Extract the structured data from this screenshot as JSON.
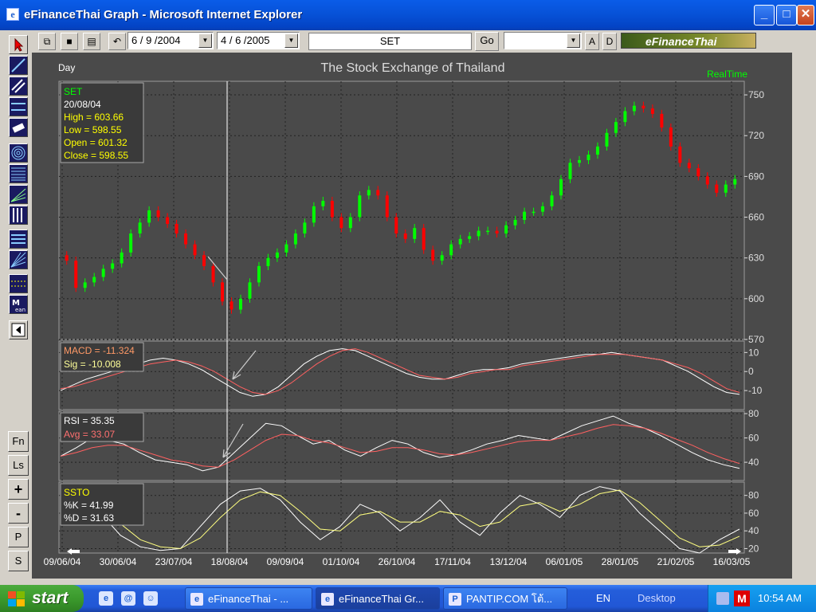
{
  "window": {
    "title": "eFinanceThai Graph - Microsoft Internet Explorer",
    "app_icon": "e",
    "minimize": "_",
    "maximize": "□",
    "close": "✕"
  },
  "toolbar": {
    "from_date": "6 / 9 /2004",
    "to_date": "4 / 6 /2005",
    "symbol": "SET",
    "go_label": "Go",
    "btn_a": "A",
    "btn_d": "D",
    "logo_text": "eFinanceThai"
  },
  "left_buttons": [
    "Fn",
    "Ls",
    "+",
    "-",
    "P",
    "S"
  ],
  "chart": {
    "period_label": "Day",
    "title": "The Stock Exchange of Thailand",
    "realtime_label": "RealTime",
    "colors": {
      "up": "#00ff00",
      "down": "#ff0000",
      "macd": "#ffffff",
      "signal": "#ff6060",
      "rsi": "#ffffff",
      "rsi_avg": "#ff6060",
      "stoch_k": "#ffffff",
      "stoch_d": "#ffff80"
    },
    "price_info": {
      "name": "SET",
      "date": "20/08/04",
      "high": "High  = 603.66",
      "low": "Low  = 598.55",
      "open": "Open = 601.32",
      "close": "Close = 598.55"
    },
    "macd_info": {
      "macd": "MACD = -11.324",
      "sig": "Sig  = -10.008"
    },
    "rsi_info": {
      "rsi": "RSI = 35.35",
      "avg": "Avg = 33.07"
    },
    "ssto_info": {
      "name": "SSTO",
      "k": "%K = 41.99",
      "d": "%D = 31.63"
    },
    "x_labels": [
      "09/06/04",
      "30/06/04",
      "23/07/04",
      "18/08/04",
      "09/09/04",
      "01/10/04",
      "26/10/04",
      "17/11/04",
      "13/12/04",
      "06/01/05",
      "28/01/05",
      "21/02/05",
      "16/03/05"
    ]
  },
  "chart_data": [
    {
      "type": "candlestick",
      "title": "The Stock Exchange of Thailand",
      "ylim": [
        570,
        760
      ],
      "yticks": [
        570,
        600,
        630,
        660,
        690,
        720,
        750
      ],
      "close": [
        628,
        608,
        612,
        616,
        622,
        626,
        634,
        648,
        656,
        665,
        660,
        655,
        648,
        640,
        632,
        624,
        612,
        598,
        592,
        600,
        612,
        624,
        630,
        634,
        640,
        648,
        656,
        668,
        672,
        660,
        652,
        660,
        676,
        680,
        676,
        660,
        648,
        644,
        652,
        636,
        628,
        632,
        640,
        644,
        646,
        650,
        650,
        648,
        654,
        658,
        664,
        664,
        668,
        676,
        688,
        700,
        702,
        706,
        712,
        722,
        730,
        738,
        742,
        740,
        736,
        726,
        712,
        700,
        696,
        690,
        684,
        678,
        684,
        688
      ]
    },
    {
      "type": "line",
      "name": "MACD",
      "ylim": [
        -20,
        16
      ],
      "yticks": [
        10,
        0,
        -10
      ],
      "series": [
        {
          "name": "MACD",
          "values": [
            -10,
            -7,
            -4,
            -2,
            0,
            2,
            4,
            6,
            7,
            6,
            4,
            1,
            -3,
            -7,
            -11,
            -13,
            -12,
            -8,
            -2,
            4,
            8,
            11,
            12,
            11,
            8,
            5,
            2,
            -1,
            -3,
            -4,
            -4,
            -2,
            0,
            1,
            1,
            2,
            4,
            5,
            6,
            7,
            8,
            9,
            9,
            10,
            9,
            8,
            7,
            6,
            3,
            0,
            -4,
            -8,
            -11,
            -12
          ]
        },
        {
          "name": "Sig",
          "values": [
            -9,
            -8,
            -6,
            -4,
            -2,
            0,
            2,
            4,
            5,
            6,
            5,
            3,
            0,
            -4,
            -8,
            -11,
            -12,
            -10,
            -6,
            -1,
            4,
            8,
            11,
            12,
            10,
            7,
            4,
            1,
            -2,
            -3,
            -4,
            -3,
            -1,
            0,
            1,
            1,
            3,
            4,
            5,
            6,
            7,
            8,
            9,
            9,
            9,
            8,
            7,
            6,
            4,
            2,
            -1,
            -5,
            -9,
            -11
          ]
        }
      ]
    },
    {
      "type": "line",
      "name": "RSI",
      "ylim": [
        25,
        82
      ],
      "yticks": [
        80,
        60,
        40
      ],
      "series": [
        {
          "name": "RSI",
          "values": [
            45,
            52,
            60,
            58,
            55,
            48,
            42,
            40,
            38,
            33,
            36,
            48,
            60,
            72,
            70,
            62,
            55,
            58,
            50,
            45,
            52,
            58,
            55,
            48,
            44,
            46,
            50,
            55,
            58,
            62,
            60,
            58,
            64,
            70,
            74,
            78,
            72,
            68,
            62,
            55,
            48,
            42,
            38,
            35
          ]
        },
        {
          "name": "Avg",
          "values": [
            45,
            48,
            52,
            54,
            54,
            50,
            46,
            42,
            40,
            37,
            36,
            42,
            50,
            58,
            63,
            62,
            58,
            56,
            52,
            48,
            49,
            52,
            52,
            50,
            47,
            46,
            48,
            51,
            54,
            57,
            58,
            58,
            61,
            64,
            68,
            71,
            70,
            68,
            64,
            59,
            54,
            48,
            43,
            39
          ]
        }
      ]
    },
    {
      "type": "line",
      "name": "SSTO",
      "ylim": [
        15,
        95
      ],
      "yticks": [
        80,
        60,
        40,
        20
      ],
      "series": [
        {
          "name": "%K",
          "values": [
            70,
            80,
            60,
            35,
            22,
            18,
            20,
            45,
            70,
            85,
            88,
            75,
            50,
            30,
            45,
            70,
            60,
            40,
            55,
            75,
            50,
            35,
            60,
            80,
            70,
            55,
            80,
            90,
            85,
            60,
            40,
            20,
            15,
            30,
            42
          ]
        },
        {
          "name": "%D",
          "values": [
            65,
            72,
            68,
            48,
            30,
            22,
            20,
            32,
            55,
            75,
            84,
            80,
            62,
            42,
            40,
            58,
            62,
            50,
            50,
            62,
            58,
            45,
            50,
            68,
            72,
            62,
            70,
            82,
            86,
            72,
            52,
            32,
            22,
            24,
            34
          ]
        }
      ]
    }
  ],
  "taskbar": {
    "start_label": "start",
    "tasks": [
      "eFinanceThai - ...",
      "eFinanceThai Gr...",
      "PANTIP.COM โต้..."
    ],
    "lang": "EN",
    "desktop": "Desktop",
    "time": "10:54 AM"
  }
}
